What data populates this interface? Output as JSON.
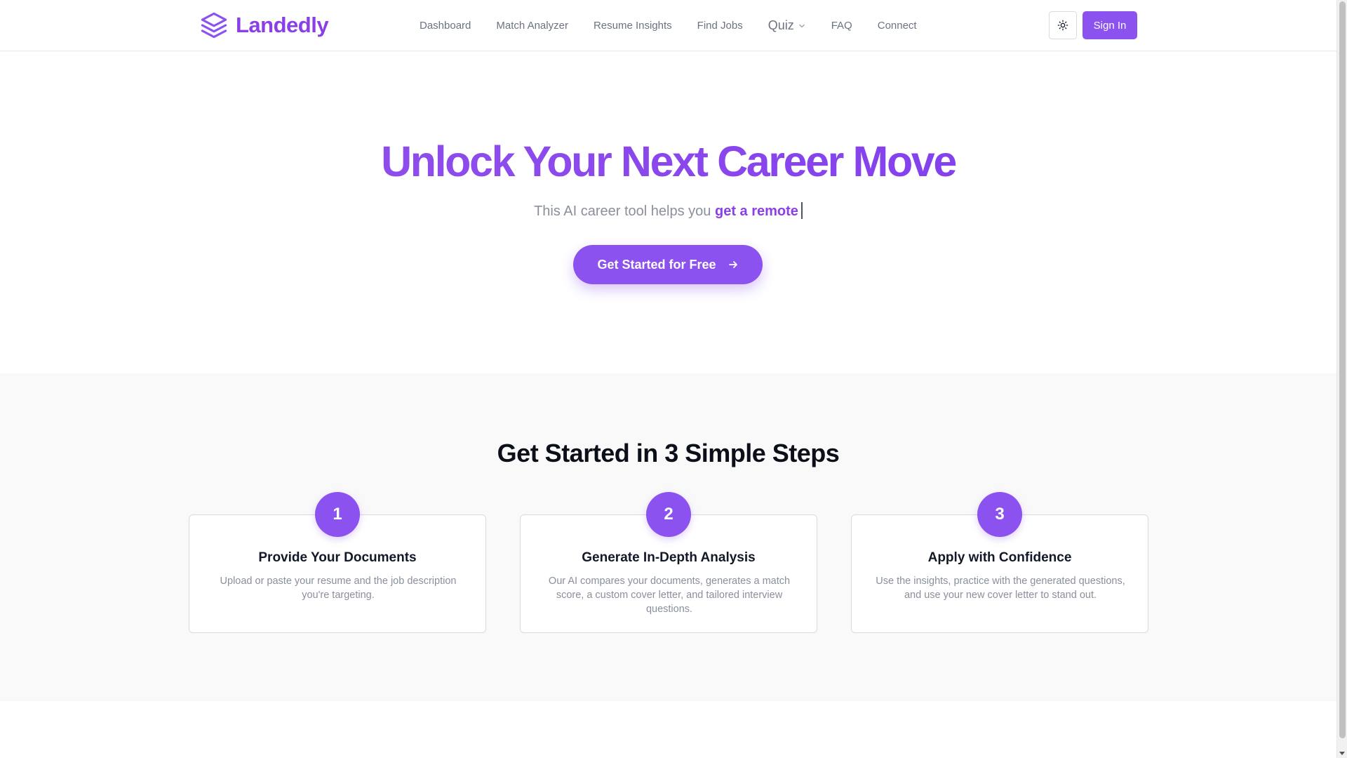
{
  "brand": {
    "name": "Landedly",
    "color": "#8b3fe6"
  },
  "nav": {
    "items": [
      {
        "label": "Dashboard"
      },
      {
        "label": "Match Analyzer"
      },
      {
        "label": "Resume Insights"
      },
      {
        "label": "Find Jobs"
      },
      {
        "label": "Quiz",
        "has_dropdown": true
      },
      {
        "label": "FAQ"
      },
      {
        "label": "Connect"
      }
    ],
    "theme_toggle_icon": "sun-icon",
    "sign_in_label": "Sign In"
  },
  "hero": {
    "title": "Unlock Your Next Career Move",
    "subtitle_prefix": "This AI career tool helps you",
    "subtitle_highlight": "get a remote",
    "cta_label": "Get Started for Free",
    "cta_icon": "arrow-right-icon"
  },
  "steps": {
    "title": "Get Started in 3 Simple Steps",
    "items": [
      {
        "number": "1",
        "title": "Provide Your Documents",
        "description": "Upload or paste your resume and the job description you're targeting."
      },
      {
        "number": "2",
        "title": "Generate In-Depth Analysis",
        "description": "Our AI compares your documents, generates a match score, a custom cover letter, and tailored interview questions."
      },
      {
        "number": "3",
        "title": "Apply with Confidence",
        "description": "Use the insights, practice with the generated questions, and use your new cover letter to stand out."
      }
    ]
  },
  "colors": {
    "accent": "#8b52ef",
    "text_muted": "#8a8f9c",
    "section_bg": "#f9f9fa"
  }
}
